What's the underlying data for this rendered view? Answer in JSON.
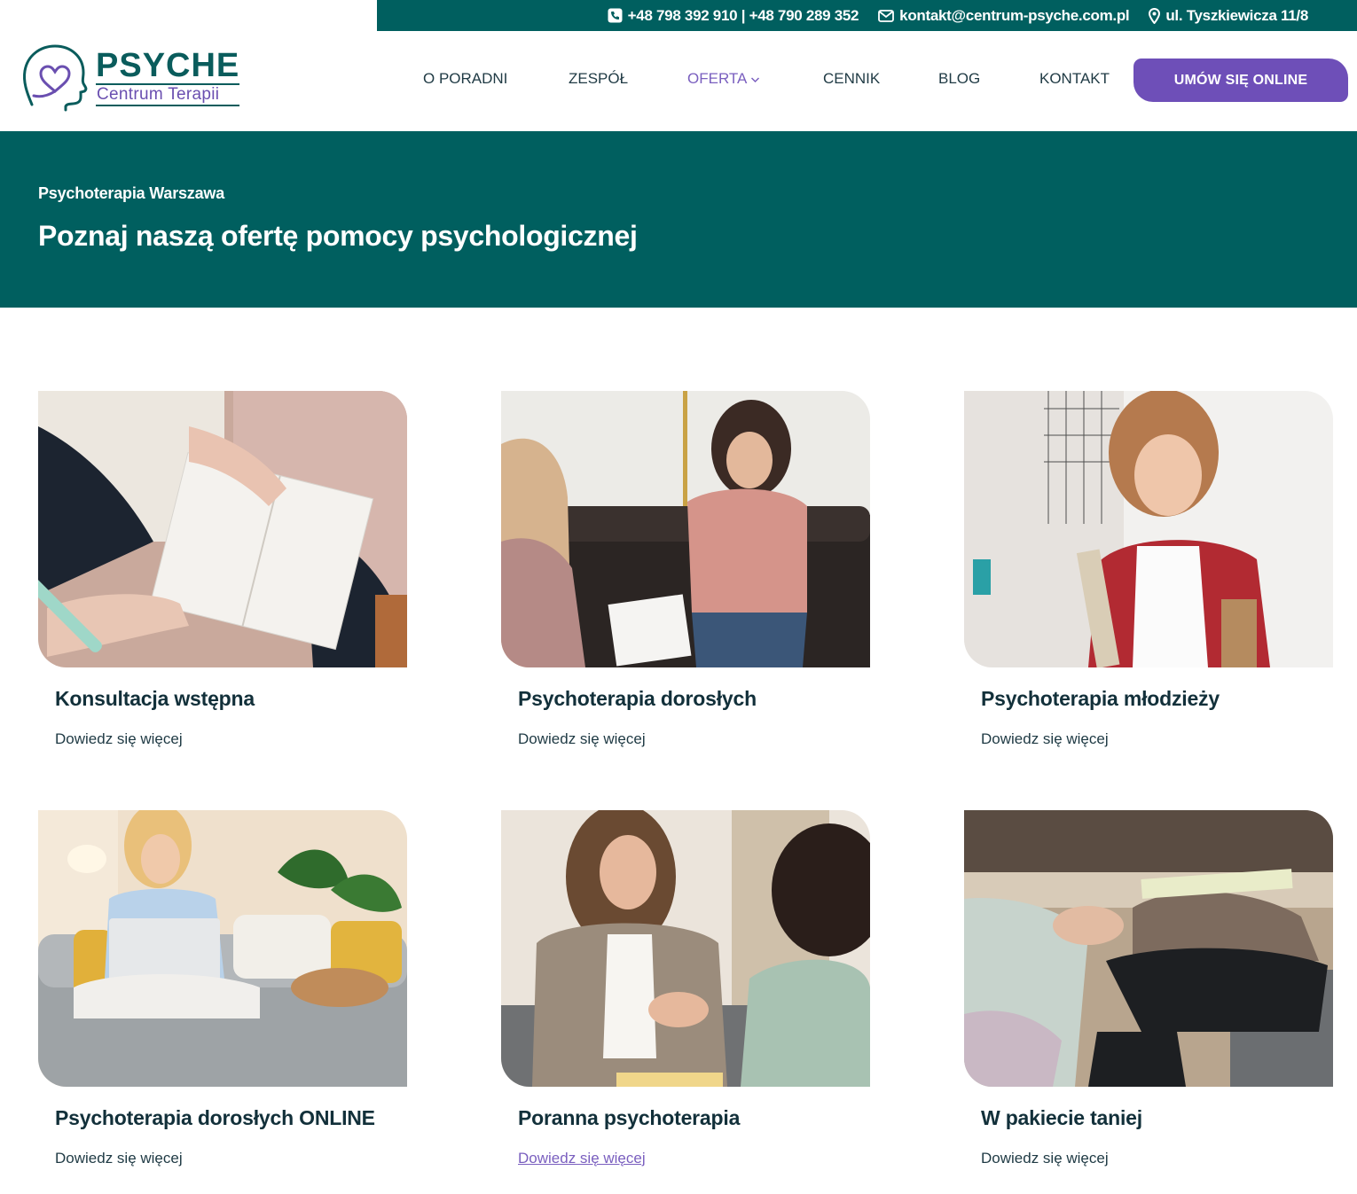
{
  "topbar": {
    "phone": "+48 798 392 910 | +48 790 289 352",
    "email": "kontakt@centrum-psyche.com.pl",
    "address": "ul. Tyszkiewicza 11/8"
  },
  "logo": {
    "title": "PSYCHE",
    "subtitle": "Centrum Terapii"
  },
  "nav": {
    "items": [
      "O PORADNI",
      "ZESPÓŁ",
      "OFERTA",
      "CENNIK",
      "BLOG",
      "KONTAKT"
    ],
    "cta": "UMÓW SIĘ ONLINE"
  },
  "hero": {
    "kicker": "Psychoterapia Warszawa",
    "title": "Poznaj naszą ofertę pomocy psychologicznej"
  },
  "cards": [
    {
      "title": "Konsultacja wstępna",
      "link": "Dowiedz się więcej"
    },
    {
      "title": "Psychoterapia dorosłych",
      "link": "Dowiedz się więcej"
    },
    {
      "title": "Psychoterapia młodzieży",
      "link": "Dowiedz się więcej"
    },
    {
      "title": "Psychoterapia dorosłych ONLINE",
      "link": "Dowiedz się więcej"
    },
    {
      "title": "Poranna psychoterapia",
      "link": "Dowiedz się więcej"
    },
    {
      "title": "W pakiecie taniej",
      "link": "Dowiedz się więcej"
    }
  ],
  "colors": {
    "brand_teal": "#005f5f",
    "brand_purple": "#6e4fb8",
    "active_nav": "#7a5fbf"
  },
  "icons": [
    "phone-icon",
    "mail-icon",
    "location-pin-icon",
    "chevron-down-icon"
  ]
}
